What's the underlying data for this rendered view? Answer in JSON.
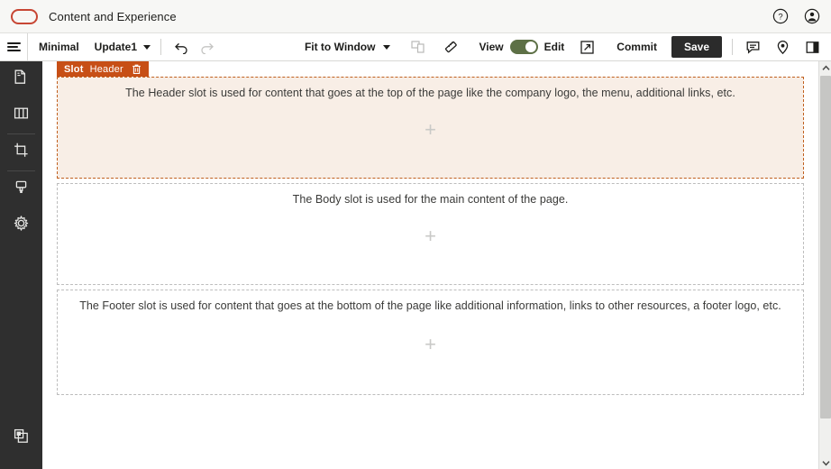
{
  "titlebar": {
    "logo": "oracle-logo",
    "title": "Content and Experience",
    "help_icon": "help-circle-icon",
    "account_icon": "user-account-icon"
  },
  "toolbar": {
    "menu_icon": "hamburger-menu-icon",
    "theme_label": "Minimal",
    "update_label": "Update1",
    "undo_icon": "undo-icon",
    "redo_icon": "redo-icon",
    "zoom_label": "Fit to Window",
    "device_preview_icon": "device-preview-icon",
    "ruler_icon": "ruler-icon",
    "view_label": "View",
    "edit_label": "Edit",
    "toggle_state": "edit",
    "preview_icon": "open-external-icon",
    "commit_label": "Commit",
    "save_label": "Save",
    "comment_icon": "comment-icon",
    "pin_icon": "location-pin-icon",
    "panel_icon": "side-panel-icon"
  },
  "sidebar": {
    "items": [
      {
        "name": "pages-icon"
      },
      {
        "name": "layout-columns-icon"
      },
      {
        "name": "crop-slot-icon"
      },
      {
        "name": "theme-brush-icon"
      },
      {
        "name": "settings-gear-icon"
      }
    ],
    "bottom_item": {
      "name": "components-icon"
    }
  },
  "canvas": {
    "badge": {
      "type_label": "Slot",
      "name_label": "Header",
      "delete_icon": "trash-icon"
    },
    "slots": [
      {
        "id": "header",
        "text": "The Header slot is used for content that goes at the top of the page like the company logo, the menu, additional links, etc.",
        "add_icon": "plus-icon",
        "selected": true,
        "background": "#f8eee6",
        "border_color": "#c0601f"
      },
      {
        "id": "body",
        "text": "The Body slot is used for the main content of the page.",
        "add_icon": "plus-icon",
        "selected": false,
        "background": "#ffffff",
        "border_color": "#bdbdbd"
      },
      {
        "id": "footer",
        "text": "The Footer slot is used for content that goes at the bottom of the page like additional information, links to other resources, a footer logo, etc.",
        "add_icon": "plus-icon",
        "selected": false,
        "background": "#ffffff",
        "border_color": "#bdbdbd"
      }
    ]
  },
  "scrollbar": {
    "up_icon": "scroll-up-arrow-icon",
    "down_icon": "scroll-down-arrow-icon",
    "thumb": "scrollbar-thumb"
  },
  "colors": {
    "oracle_red": "#c74634",
    "slot_orange": "#c74f16",
    "toggle_green": "#5d7046",
    "save_dark": "#2b2b2b",
    "sidebar_dark": "#2f2f2f"
  }
}
